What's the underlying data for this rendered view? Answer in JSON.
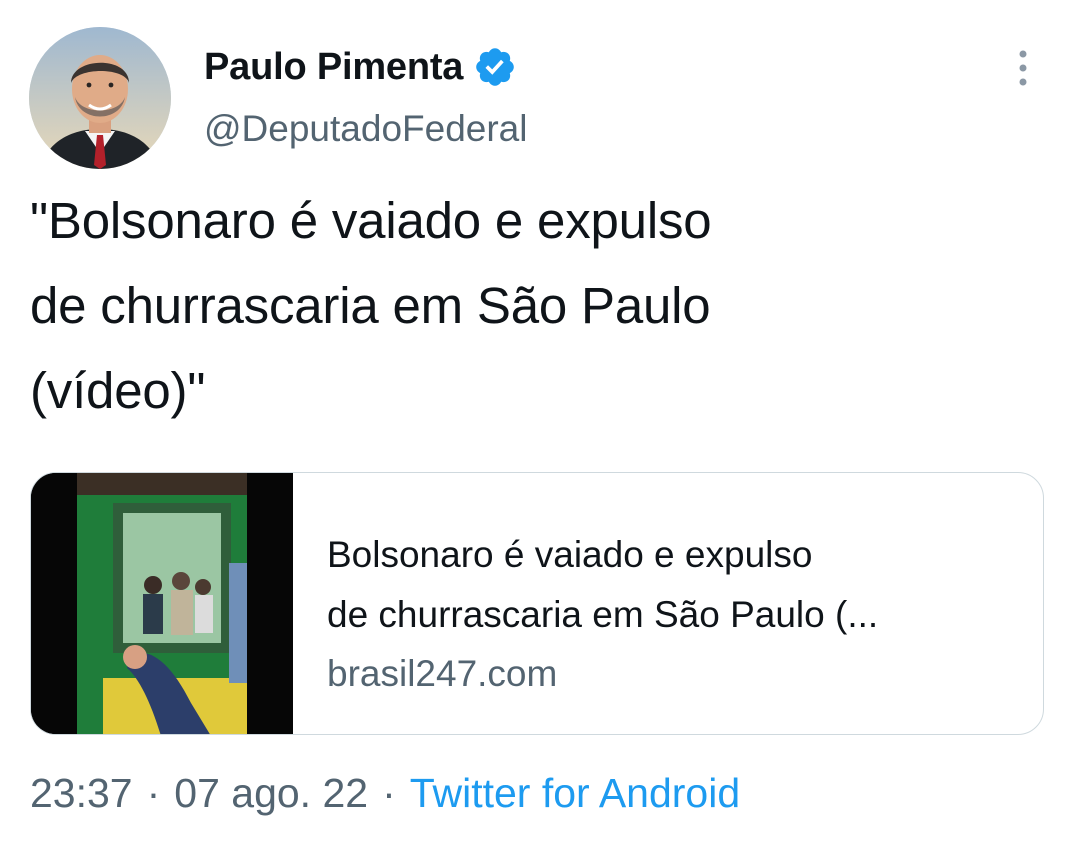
{
  "author": {
    "display_name": "Paulo Pimenta",
    "handle": "@DeputadoFederal",
    "verified_icon": "verified-badge-icon",
    "avatar_icon": "profile-photo"
  },
  "menu": {
    "icon": "more-vertical-icon"
  },
  "tweet": {
    "text": "\"Bolsonaro é vaiado e expulso\nde churrascaria em São Paulo\n(vídeo)\""
  },
  "card": {
    "title": "Bolsonaro é vaiado e expulso\nde churrascaria em São Paulo (...",
    "domain": "brasil247.com",
    "thumbnail_icon": "video-thumbnail"
  },
  "meta": {
    "time": "23:37",
    "separator": "·",
    "date": "07 ago. 22",
    "source": "Twitter for Android"
  },
  "colors": {
    "primary_text": "#0f1419",
    "secondary_text": "#536471",
    "accent": "#1d9bf0",
    "border": "#cfd9de"
  }
}
